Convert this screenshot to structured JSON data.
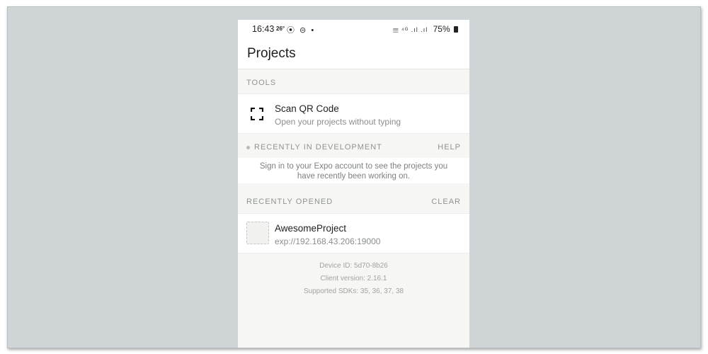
{
  "status_bar": {
    "time": "16:43",
    "temperature": "26°",
    "left_icons": "⦿ ⊝ •",
    "signal": "𝄙 ⁴ᴳ .ıl .ıl",
    "battery": "75%"
  },
  "app_bar": {
    "title": "Projects"
  },
  "tools": {
    "header": "TOOLS",
    "scan": {
      "icon": "qr-scan-icon",
      "title": "Scan QR Code",
      "subtitle": "Open your projects without typing"
    }
  },
  "recent_dev": {
    "header": "RECENTLY IN DEVELOPMENT",
    "action": "HELP",
    "message_line1": "Sign in to your Expo account to see the projects you",
    "message_line2": "have recently been working on."
  },
  "recent_opened": {
    "header": "RECENTLY OPENED",
    "action": "CLEAR",
    "projects": [
      {
        "name": "AwesomeProject",
        "url": "exp://192.168.43.206:19000"
      }
    ]
  },
  "footer": {
    "device_id": "Device ID: 5d70-8b26",
    "client_version": "Client version: 2.16.1",
    "supported_sdks": "Supported SDKs: 35, 36, 37, 38"
  }
}
